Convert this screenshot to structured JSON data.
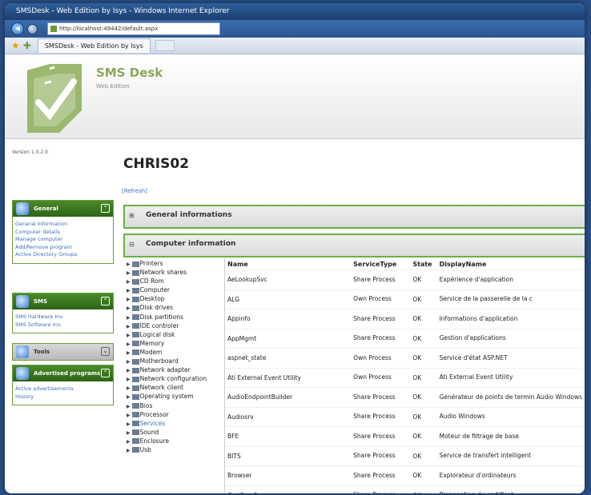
{
  "window": {
    "title": "SMSDesk - Web Edition by Isys - Windows Internet Explorer",
    "address": "http://localhost:49442/default.aspx",
    "tab_label": "SMSDesk - Web Edition by Isys"
  },
  "app": {
    "title": "SMS Desk",
    "subtitle": "Web Edition"
  },
  "left": {
    "version": "Version 1.0.2.0",
    "general": {
      "title": "General",
      "items": [
        "General information",
        "Computer details",
        "Manage computer",
        "Add/Remove program",
        "Active Directory Groups"
      ]
    },
    "sms": {
      "title": "SMS",
      "items": [
        "SMS Hardware Inv.",
        "SMS Software Inv."
      ]
    },
    "tools": {
      "title": "Tools"
    },
    "advertised": {
      "title": "Advertised programs",
      "items": [
        "Active advertisements",
        "History"
      ]
    }
  },
  "main": {
    "computer_name": "CHRIS02",
    "refresh": "[Refresh]",
    "section_general": "General informations",
    "section_computer": "Computer information"
  },
  "tree": [
    "Printers",
    "Network shares",
    "CD Rom",
    "Computer",
    "Desktop",
    "Disk drives",
    "Disk partitions",
    "IDE controler",
    "Logical disk",
    "Memory",
    "Modem",
    "Motherboard",
    "Network adapter",
    "Network configuration",
    "Network client",
    "Operating system",
    "Bios",
    "Processor",
    "Services",
    "Sound",
    "Enclosure",
    "Usb"
  ],
  "tree_selected": "Services",
  "table": {
    "columns": [
      "Name",
      "ServiceType",
      "State",
      "DisplayName"
    ],
    "rows": [
      [
        "AeLookupSvc",
        "Share Process",
        "OK",
        "Expérience d'application"
      ],
      [
        "ALG",
        "Own Process",
        "OK",
        "Service de la passerelle de la c"
      ],
      [
        "Appinfo",
        "Share Process",
        "OK",
        "Informations d'application"
      ],
      [
        "AppMgmt",
        "Share Process",
        "OK",
        "Gestion d'applications"
      ],
      [
        "aspnet_state",
        "Own Process",
        "OK",
        "Service d'état ASP.NET"
      ],
      [
        "Ati External Event Utility",
        "Own Process",
        "OK",
        "Ati External Event Utility"
      ],
      [
        "AudioEndpointBuilder",
        "Share Process",
        "OK",
        "Générateur de points de termin Audio Windows"
      ],
      [
        "Audiosrv",
        "Share Process",
        "OK",
        "Audio Windows"
      ],
      [
        "BFE",
        "Share Process",
        "OK",
        "Moteur de filtrage de base"
      ],
      [
        "BITS",
        "Share Process",
        "OK",
        "Service de transfert intelligent"
      ],
      [
        "Browser",
        "Share Process",
        "OK",
        "Explorateur d'ordinateurs"
      ],
      [
        "CertPropSvc",
        "Share Process",
        "OK",
        "Propagation du certificat"
      ]
    ]
  },
  "colors": {
    "accent": "#6bb043",
    "link": "#3d6fb6",
    "ie_blue": "#2e5f9c"
  }
}
